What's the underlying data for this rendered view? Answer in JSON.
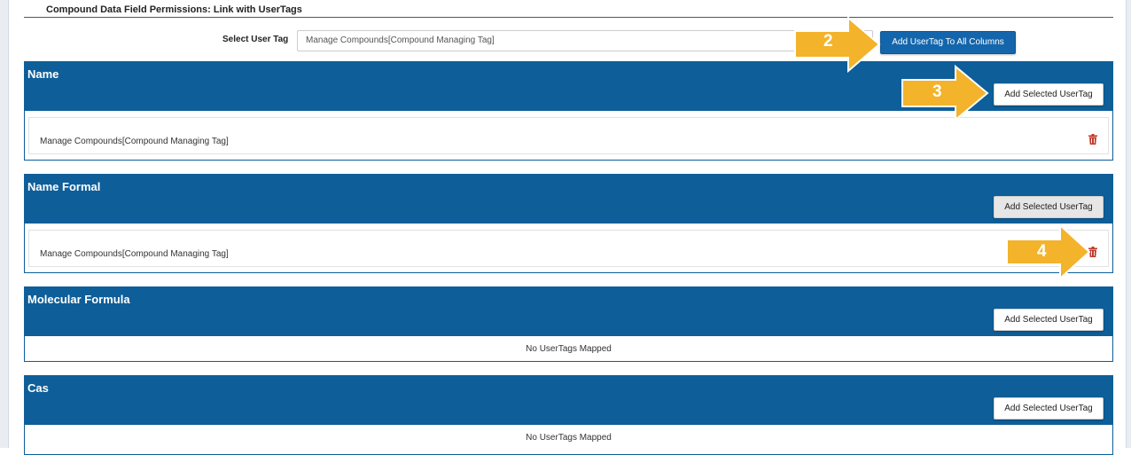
{
  "header": {
    "title": "Compound Data Field Permissions: Link with UserTags",
    "select_label": "Select User Tag",
    "select_value": "Manage Compounds[Compound Managing Tag]",
    "add_all_label": "Add UserTag To All Columns"
  },
  "panels": [
    {
      "title": "Name",
      "button_label": "Add Selected UserTag",
      "tags": [
        "Manage Compounds[Compound Managing Tag]"
      ],
      "empty_text": ""
    },
    {
      "title": "Name Formal",
      "button_label": "Add Selected UserTag",
      "tags": [
        "Manage Compounds[Compound Managing Tag]"
      ],
      "empty_text": ""
    },
    {
      "title": "Molecular Formula",
      "button_label": "Add Selected UserTag",
      "tags": [],
      "empty_text": "No UserTags Mapped"
    },
    {
      "title": "Cas",
      "button_label": "Add Selected UserTag",
      "tags": [],
      "empty_text": "No UserTags Mapped"
    }
  ],
  "callouts": {
    "step_2": "2",
    "step_3": "3",
    "step_4": "4"
  },
  "colors": {
    "panel_header": "#0e5e99",
    "primary_button": "#1466ac",
    "callout_arrow": "#f3b32a",
    "trash_icon": "#c0392b"
  }
}
